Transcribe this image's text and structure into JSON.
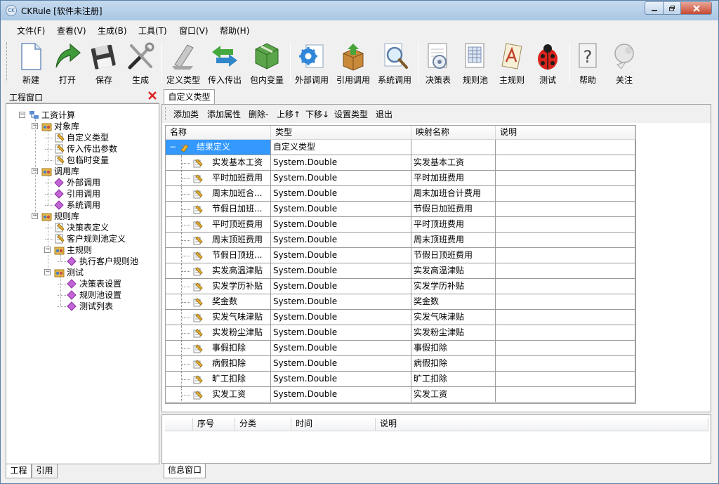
{
  "window": {
    "title": "CKRule [软件未注册]",
    "app_icon": "CK",
    "minimize_icon": "minimize-icon",
    "maximize_icon": "maximize-icon",
    "close_icon": "close-icon"
  },
  "menu": [
    "文件(F)",
    "查看(V)",
    "生成(B)",
    "工具(T)",
    "窗口(V)",
    "帮助(H)"
  ],
  "toolbar": [
    {
      "label": "新建",
      "icon": "new-file-icon"
    },
    {
      "label": "打开",
      "icon": "open-arrow-icon"
    },
    {
      "label": "保存",
      "icon": "floppy-disk-icon"
    },
    {
      "label": "生成",
      "icon": "tools-icon"
    },
    {
      "label": "定义类型",
      "icon": "define-type-icon"
    },
    {
      "label": "传入传出",
      "icon": "in-out-arrows-icon"
    },
    {
      "label": "包内变量",
      "icon": "package-icon"
    },
    {
      "label": "外部调用",
      "icon": "gear-document-icon"
    },
    {
      "label": "引用调用",
      "icon": "reference-box-icon"
    },
    {
      "label": "系统调用",
      "icon": "magnifier-icon"
    },
    {
      "label": "决策表",
      "icon": "decision-table-icon"
    },
    {
      "label": "规则池",
      "icon": "rule-pool-icon"
    },
    {
      "label": "主规则",
      "icon": "main-rule-icon"
    },
    {
      "label": "测试",
      "icon": "ladybug-icon"
    },
    {
      "label": "帮助",
      "icon": "help-icon"
    },
    {
      "label": "关注",
      "icon": "follow-icon"
    }
  ],
  "left_panel": {
    "title": "工程窗口",
    "tree": [
      {
        "label": "工资计算",
        "level": 0,
        "icon": "project-icon",
        "expandable": true
      },
      {
        "label": "对象库",
        "level": 1,
        "icon": "library-icon",
        "expandable": true
      },
      {
        "label": "自定义类型",
        "level": 2,
        "icon": "type-icon",
        "expandable": false
      },
      {
        "label": "传入传出参数",
        "level": 2,
        "icon": "type-icon",
        "expandable": false
      },
      {
        "label": "包临时变量",
        "level": 2,
        "icon": "type-icon",
        "expandable": false
      },
      {
        "label": "调用库",
        "level": 1,
        "icon": "library-icon",
        "expandable": true
      },
      {
        "label": "外部调用",
        "level": 2,
        "icon": "diamond-icon",
        "expandable": false
      },
      {
        "label": "引用调用",
        "level": 2,
        "icon": "diamond-icon",
        "expandable": false
      },
      {
        "label": "系统调用",
        "level": 2,
        "icon": "diamond-icon",
        "expandable": false
      },
      {
        "label": "规则库",
        "level": 1,
        "icon": "library-icon",
        "expandable": true
      },
      {
        "label": "决策表定义",
        "level": 2,
        "icon": "type-icon",
        "expandable": false
      },
      {
        "label": "客户规则池定义",
        "level": 2,
        "icon": "type-icon",
        "expandable": false
      },
      {
        "label": "主规则",
        "level": 2,
        "icon": "library-icon",
        "expandable": true
      },
      {
        "label": "执行客户规则池",
        "level": 3,
        "icon": "diamond-icon",
        "expandable": false
      },
      {
        "label": "测试",
        "level": 2,
        "icon": "library-icon",
        "expandable": true
      },
      {
        "label": "决策表设置",
        "level": 3,
        "icon": "diamond-icon",
        "expandable": false
      },
      {
        "label": "规则池设置",
        "level": 3,
        "icon": "diamond-icon",
        "expandable": false
      },
      {
        "label": "测试列表",
        "level": 3,
        "icon": "diamond-icon",
        "expandable": false
      }
    ],
    "tabs": [
      "工程",
      "引用"
    ]
  },
  "document": {
    "tab": "自定义类型",
    "actions": [
      "添加类",
      "添加属性",
      "删除-",
      "上移↑",
      "下移↓",
      "设置类型",
      "退出"
    ],
    "columns": [
      "名称",
      "类型",
      "映射名称",
      "说明"
    ],
    "root": {
      "name": "结果定义",
      "type": "自定义类型",
      "mapped": "",
      "desc": ""
    },
    "rows": [
      {
        "name": "实发基本工资",
        "type": "System.Double",
        "mapped": "实发基本工资",
        "desc": ""
      },
      {
        "name": "平时加班费用",
        "type": "System.Double",
        "mapped": "平时加班费用",
        "desc": ""
      },
      {
        "name": "周末加班合...",
        "type": "System.Double",
        "mapped": "周末加班合计费用",
        "desc": ""
      },
      {
        "name": "节假日加班...",
        "type": "System.Double",
        "mapped": "节假日加班费用",
        "desc": ""
      },
      {
        "name": "平时顶班费用",
        "type": "System.Double",
        "mapped": "平时顶班费用",
        "desc": ""
      },
      {
        "name": "周末顶班费用",
        "type": "System.Double",
        "mapped": "周末顶班费用",
        "desc": ""
      },
      {
        "name": "节假日顶班...",
        "type": "System.Double",
        "mapped": "节假日顶班费用",
        "desc": ""
      },
      {
        "name": "实发高温津贴",
        "type": "System.Double",
        "mapped": "实发高温津贴",
        "desc": ""
      },
      {
        "name": "实发学历补贴",
        "type": "System.Double",
        "mapped": "实发学历补贴",
        "desc": ""
      },
      {
        "name": "奖金数",
        "type": "System.Double",
        "mapped": "奖金数",
        "desc": ""
      },
      {
        "name": "实发气味津贴",
        "type": "System.Double",
        "mapped": "实发气味津贴",
        "desc": ""
      },
      {
        "name": "实发粉尘津贴",
        "type": "System.Double",
        "mapped": "实发粉尘津贴",
        "desc": ""
      },
      {
        "name": "事假扣除",
        "type": "System.Double",
        "mapped": "事假扣除",
        "desc": ""
      },
      {
        "name": "病假扣除",
        "type": "System.Double",
        "mapped": "病假扣除",
        "desc": ""
      },
      {
        "name": "旷工扣除",
        "type": "System.Double",
        "mapped": "旷工扣除",
        "desc": ""
      },
      {
        "name": "实发工资",
        "type": "System.Double",
        "mapped": "实发工资",
        "desc": ""
      }
    ]
  },
  "info_panel": {
    "columns": [
      "序号",
      "分类",
      "时间",
      "说明"
    ],
    "tab": "信息窗口"
  },
  "colors": {
    "selection": "#3399ff",
    "titlebar": "#b9d1ea",
    "close_button": "#c74a33"
  }
}
